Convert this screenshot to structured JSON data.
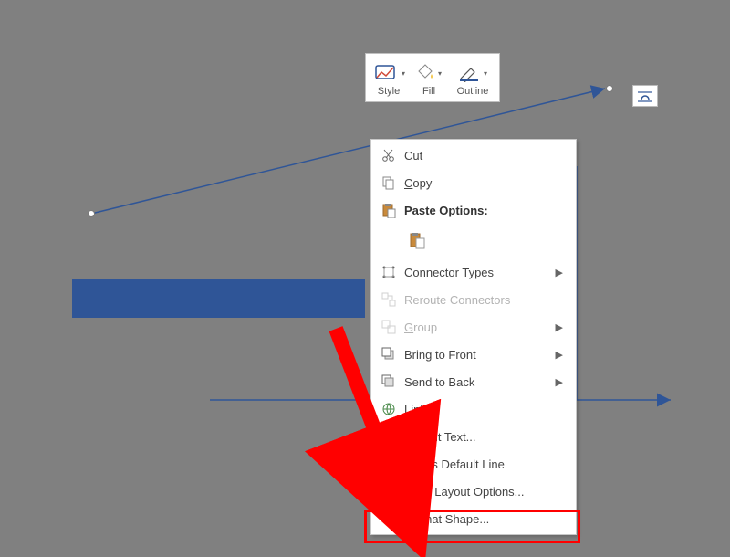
{
  "mini_toolbar": {
    "style_label": "Style",
    "fill_label": "Fill",
    "outline_label": "Outline"
  },
  "context_menu": {
    "cut": "Cut",
    "copy": "Copy",
    "paste_options": "Paste Options:",
    "connector_types": "Connector Types",
    "reroute_connectors": "Reroute Connectors",
    "group": "Group",
    "bring_to_front": "Bring to Front",
    "send_to_back": "Send to Back",
    "link": "Link",
    "edit_alt_text": "Edit Alt Text...",
    "set_default_line": "Set as Default Line",
    "more_layout_options": "More Layout Options...",
    "format_shape": "Format Shape..."
  },
  "colors": {
    "accent_blue": "#2f5597",
    "annotation_red": "#ff0000"
  }
}
